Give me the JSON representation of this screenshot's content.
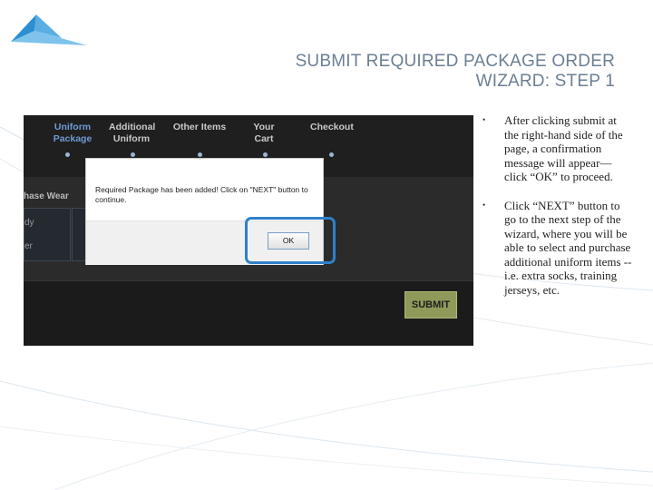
{
  "slide": {
    "title_line1": "SUBMIT REQUIRED PACKAGE ORDER",
    "title_line2": "WIZARD: STEP 1"
  },
  "wizard": {
    "steps": [
      {
        "label_line1": "Uniform Package",
        "label_line2": "",
        "active": true
      },
      {
        "label_line1": "Additional",
        "label_line2": "Uniform",
        "active": false
      },
      {
        "label_line1": "Other Items",
        "label_line2": "",
        "active": false
      },
      {
        "label_line1": "Your Cart",
        "label_line2": "",
        "active": false
      },
      {
        "label_line1": "Checkout",
        "label_line2": "",
        "active": false
      }
    ],
    "section_label": "hase Wear",
    "side_text_1": "dy",
    "side_text_2": "er",
    "submit_label": "SUBMIT"
  },
  "dialog": {
    "message": "Required Package has been added! Click on \"NEXT\" button to continue.",
    "ok_label": "OK"
  },
  "bullets": [
    "After clicking submit at the right-hand side of the page, a confirmation message will appear—click “OK” to proceed.",
    "Click “NEXT” button to go to the next step of the wizard, where you will be able to select and purchase additional uniform items --i.e. extra socks, training jerseys, etc."
  ],
  "bullet_glyph": "•",
  "colors": {
    "title": "#6b7f93",
    "highlight": "#2f80c8",
    "active_step": "#6f9ad3",
    "submit": "#8f9a5a"
  }
}
